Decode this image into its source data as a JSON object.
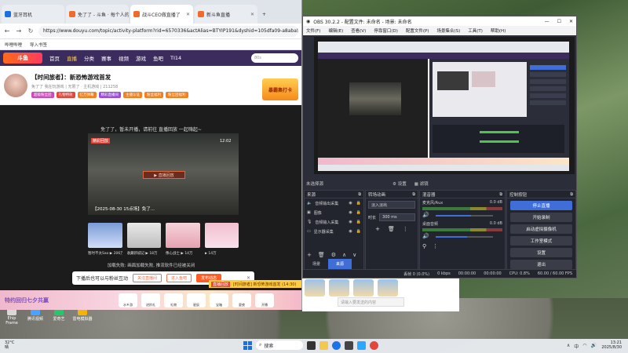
{
  "browser": {
    "tabs": [
      {
        "label": "蓝牙耳机"
      },
      {
        "label": "免了了 - 斗鱼 · 每个人的..."
      },
      {
        "label": "战斗CEO做直播了"
      },
      {
        "label": "新斗鱼直播"
      }
    ],
    "url": "https://www.douyu.com/topic/activity-platform?rid=6570336&actAlias=BTYIP191&dyshid=105dfa09-a8aba582",
    "bookmarks": [
      "哔哩哔哩",
      "导入书签"
    ],
    "nav": {
      "logo": "斗鱼",
      "items": [
        "首页",
        "直播",
        "分类",
        "赛事",
        "视频",
        "游戏",
        "鱼吧",
        "TI14"
      ],
      "search_placeholder": "80s"
    },
    "room": {
      "title": "【时间旅者】：新恐怖游戏首发",
      "meta": "我在玩游戏  |  无限了  ·  主机游戏  |  211258",
      "streamer": "免了了",
      "badges": [
        "超级粉丝团",
        "礼物特效",
        "亿万弹幕",
        "精彩直播间",
        "主播认证",
        "粉丝福利",
        "粉丝团福利"
      ],
      "ad": "暴霸集打卡"
    },
    "player": {
      "danmu": "免了了，暂未开播，请前往 直播回放 一起嗨起~",
      "tag": "精彩回放",
      "duration": "12:02",
      "highlight": "▶ 直播回放",
      "caption": "【2025-08-30 15点场】免了...",
      "thumbs": [
        {
          "label": "暂时不太Sao  ▶ 206万"
        },
        {
          "label": "收藏新城记  ▶ 18万"
        },
        {
          "label": "像心战士  ▶ 14万"
        },
        {
          "label": "▶ 14万"
        }
      ],
      "notice": "加载失败: 画面加载失败, 推流软件已经被关闭",
      "popup": {
        "text": "下播后也可以与粉丝互动",
        "btn1": "关注直播间",
        "btn2": "进入鱼吧",
        "btn3": "发布动态"
      },
      "ticker_tag": "直播回放",
      "ticker_text": "[时间旅者] 新恐怖游戏首发 (14:30)"
    },
    "banner": {
      "title": "特约回归七夕共赢",
      "items": [
        "水乡游",
        "进阶礼",
        "礼物",
        "星辰",
        "宝箱",
        "夏夜",
        "开播"
      ]
    }
  },
  "browser2": {
    "input_placeholder": "请输入要发送的内容"
  },
  "obs": {
    "title": "OBS 30.2.2 - 配置文件: 未命名 - 场景: 未命名",
    "menu": [
      "文件(F)",
      "编辑(E)",
      "查看(V)",
      "停靠窗口(D)",
      "配置文件(P)",
      "场景集合(S)",
      "工具(T)",
      "帮助(H)"
    ],
    "scene_bar": {
      "left": "未选择源",
      "tab1": "设置",
      "tab2": "滤镜"
    },
    "scenes_header": "来源",
    "sources": [
      {
        "label": "音频输出采集"
      },
      {
        "label": "图像"
      },
      {
        "label": "音频输入采集"
      },
      {
        "label": "显示器采集"
      }
    ],
    "panel_tabs": [
      "场景",
      "来源"
    ],
    "transitions_header": "转场动画",
    "transition_value": "淡入淡出",
    "duration_label": "时长",
    "duration_value": "300 ms",
    "mixer_header": "混音器",
    "mixer": [
      {
        "name": "麦克风/Aux",
        "db": "0.0 dB",
        "level": 0.62
      },
      {
        "name": "桌面音频",
        "db": "0.0 dB",
        "level": 0.55
      }
    ],
    "controls_header": "控制按钮",
    "controls": [
      "停止直播",
      "开始录制",
      "启动虚拟摄像机",
      "工作室模式",
      "设置",
      "退出"
    ],
    "status": [
      "丢帧 0 (0.0%)",
      "0 kbps",
      "00:00:00",
      "00:00:00",
      "CPU: 0.8%",
      "60.00 / 60.00 FPS"
    ]
  },
  "desktop": {
    "icons": [
      "Ehip Frame",
      "腾讯视频",
      "爱奇艺",
      "雷电模拟器"
    ]
  },
  "taskbar": {
    "weather_temp": "32°C",
    "weather_text": "晴",
    "search": "搜索",
    "time": "13:21",
    "date": "2025/8/30",
    "lang": "中"
  },
  "colors": {
    "accent": "#3f6ed8",
    "douyu_orange": "#ff5d25",
    "douyu_purple": "#3c2c5e"
  }
}
